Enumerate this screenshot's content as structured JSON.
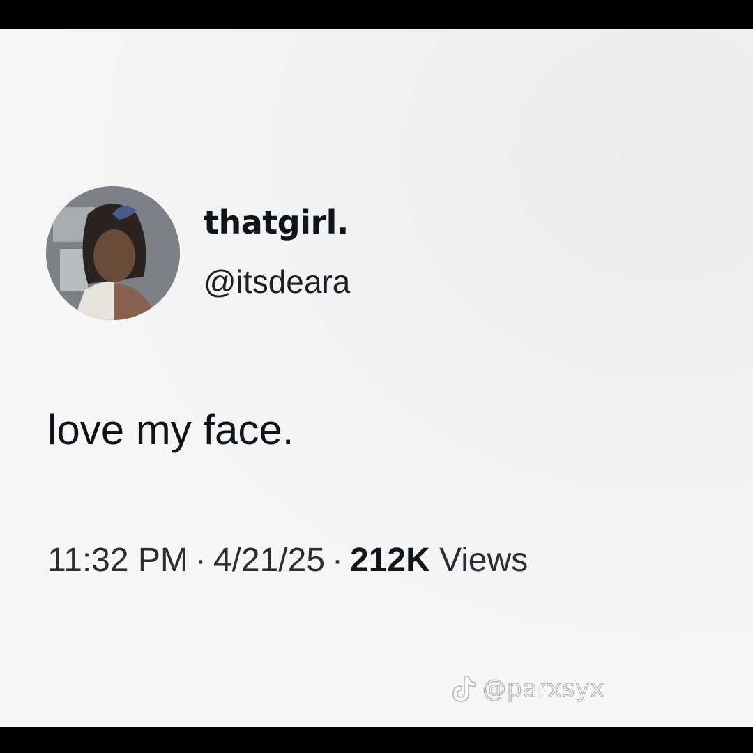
{
  "tweet": {
    "author": {
      "display_name": "thatgirl.",
      "handle": "@itsdeara"
    },
    "text": "love my face.",
    "meta": {
      "time": "11:32 PM",
      "separator": "·",
      "date": "4/21/25",
      "views_count": "212K",
      "views_label": "Views"
    }
  },
  "watermark": {
    "icon": "tiktok-icon",
    "text": "@parxsyx"
  },
  "colors": {
    "text_primary": "#0f1419",
    "background": "#f4f4f5",
    "letterbox": "#000000"
  }
}
